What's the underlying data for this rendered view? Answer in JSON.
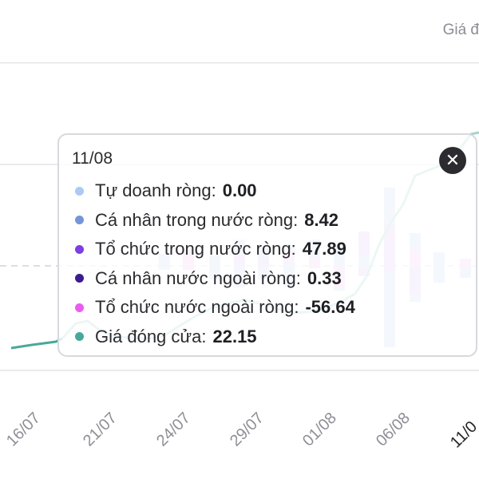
{
  "header": {
    "right_label": "Giá đ"
  },
  "chart": {
    "x_tick_labels": [
      "16/07",
      "21/07",
      "24/07",
      "29/07",
      "01/08",
      "06/08",
      "11/0"
    ],
    "colors": {
      "tu_doanh": "#a9cbf3",
      "ca_nhan_trong_nuoc": "#7396d8",
      "to_chuc_trong_nuoc": "#7b3fe4",
      "ca_nhan_nuoc_ngoai": "#3b1d8f",
      "to_chuc_nuoc_ngoai": "#ea5cf0",
      "gia_dong_cua": "#4aa89a"
    }
  },
  "tooltip": {
    "date": "11/08",
    "rows": [
      {
        "label": "Tự doanh ròng:",
        "value": "0.00",
        "color": "#a9cbf3"
      },
      {
        "label": "Cá nhân trong nước ròng:",
        "value": "8.42",
        "color": "#7396d8"
      },
      {
        "label": "Tổ chức trong nước ròng:",
        "value": "47.89",
        "color": "#7b3fe4"
      },
      {
        "label": "Cá nhân nước ngoài ròng:",
        "value": "0.33",
        "color": "#3b1d8f"
      },
      {
        "label": "Tổ chức nước ngoài ròng:",
        "value": "-56.64",
        "color": "#ea5cf0"
      },
      {
        "label": "Giá đóng cửa:",
        "value": "22.15",
        "color": "#4aa89a"
      }
    ],
    "close_icon": "close-icon"
  }
}
